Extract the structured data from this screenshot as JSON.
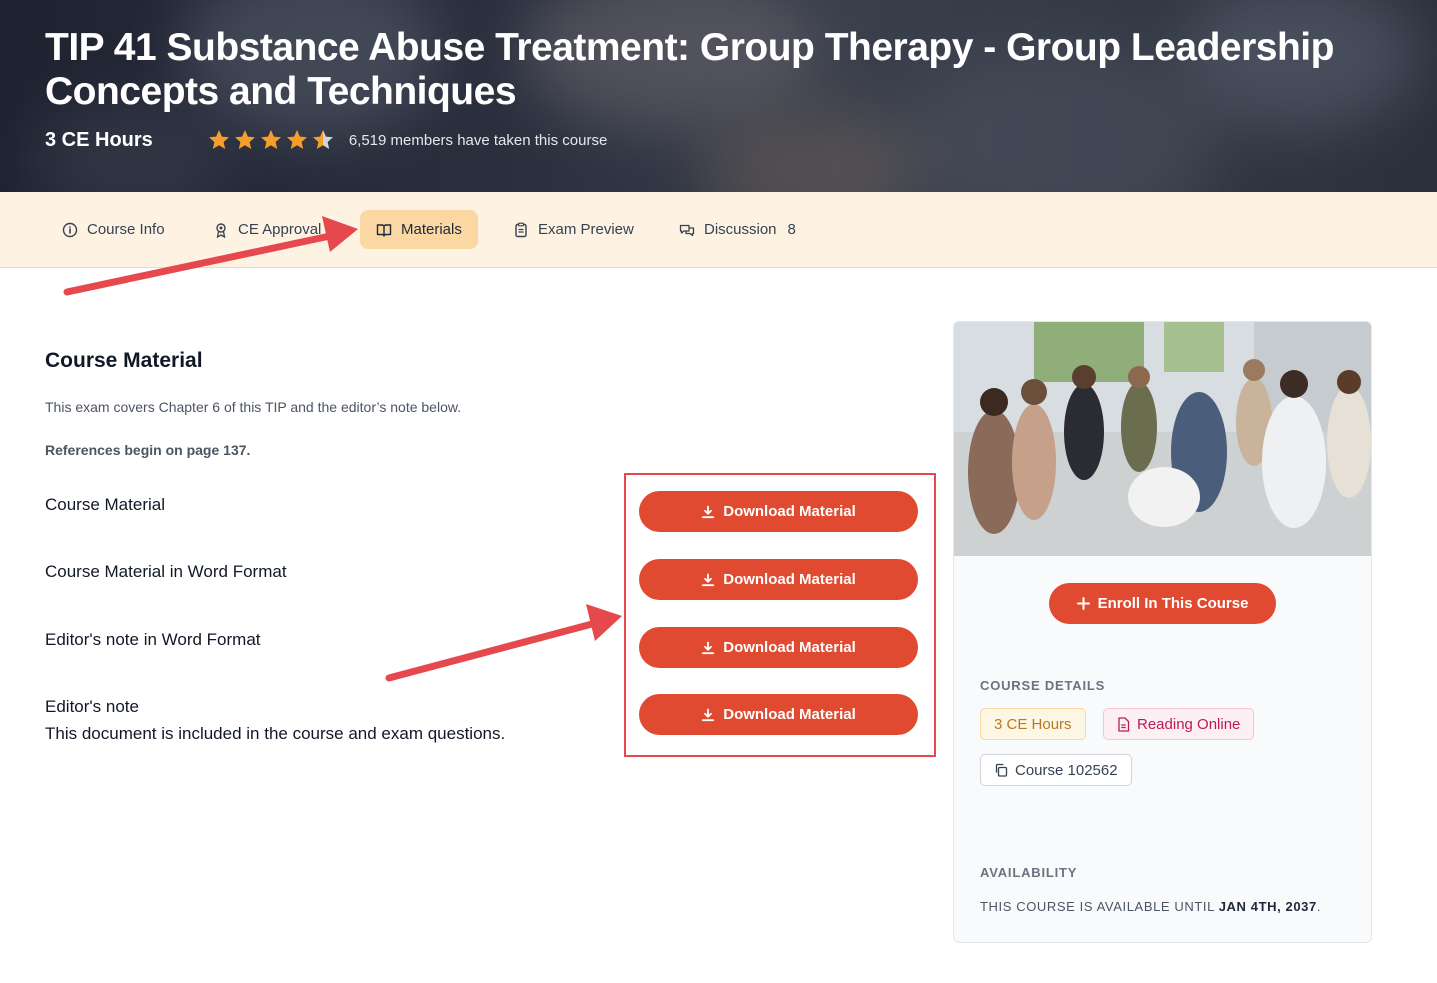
{
  "hero": {
    "title": "TIP 41 Substance Abuse Treatment: Group Therapy - Group Leadership Concepts and Techniques",
    "ce_hours": "3 CE Hours",
    "rating": 4.5,
    "members": "6,519 members have taken this course"
  },
  "tabs": [
    {
      "label": "Course Info",
      "icon": "info-icon"
    },
    {
      "label": "CE Approval",
      "icon": "award-icon"
    },
    {
      "label": "Materials",
      "icon": "book-icon",
      "active": true
    },
    {
      "label": "Exam Preview",
      "icon": "clipboard-icon"
    },
    {
      "label": "Discussion",
      "icon": "chat-icon",
      "count": "8"
    }
  ],
  "main": {
    "title": "Course Material",
    "intro": "This exam covers Chapter 6 of this TIP and the editor’s note below.",
    "references": "References begin on page 137.",
    "materials": [
      {
        "label": "Course Material",
        "sub": "",
        "button": "Download Material"
      },
      {
        "label": "Course Material in Word Format",
        "sub": "",
        "button": "Download Material"
      },
      {
        "label": "Editor's note in Word Format",
        "sub": "",
        "button": "Download Material"
      },
      {
        "label": "Editor's note",
        "sub": "This document is included in the course and exam questions.",
        "button": "Download Material"
      }
    ]
  },
  "sidebar": {
    "enroll_label": "Enroll In This Course",
    "details_heading": "COURSE DETAILS",
    "badge_ce": "3 CE Hours",
    "badge_reading": "Reading Online",
    "badge_course": "Course 102562",
    "availability_heading": "AVAILABILITY",
    "availability_text": "THIS COURSE IS AVAILABLE UNTIL",
    "availability_date": "JAN 4TH, 2037"
  },
  "colors": {
    "accent": "#e04a30",
    "star": "#f59e2b",
    "tab_bar": "#fef3e2",
    "tab_active": "#fbd7a3",
    "annotation": "#e5484d"
  }
}
